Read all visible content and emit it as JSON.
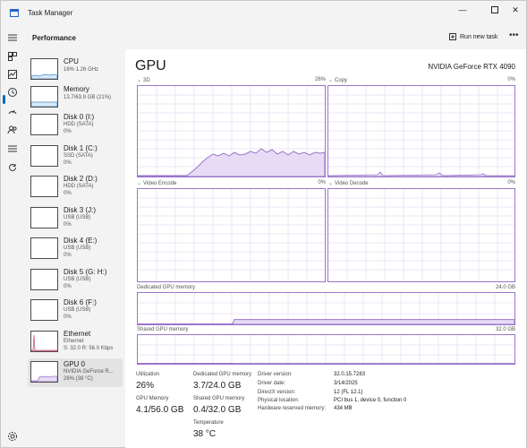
{
  "window": {
    "title": "Task Manager"
  },
  "header": {
    "title": "Performance",
    "run_new_task": "Run new task",
    "more_label": "•••"
  },
  "devices": [
    {
      "name": "CPU",
      "sub1": "16%  1.26 GHz",
      "sub2": ""
    },
    {
      "name": "Memory",
      "sub1": "13.7/63.9 GB (21%)",
      "sub2": ""
    },
    {
      "name": "Disk 0 (I:)",
      "sub1": "HDD (SATA)",
      "sub2": "0%"
    },
    {
      "name": "Disk 1 (C:)",
      "sub1": "SSD (SATA)",
      "sub2": "0%"
    },
    {
      "name": "Disk 2 (D:)",
      "sub1": "HDD (SATA)",
      "sub2": "0%"
    },
    {
      "name": "Disk 3 (J:)",
      "sub1": "USB (USB)",
      "sub2": "0%"
    },
    {
      "name": "Disk 4 (E:)",
      "sub1": "USB (USB)",
      "sub2": "0%"
    },
    {
      "name": "Disk 5 (G: H:)",
      "sub1": "USB (USB)",
      "sub2": "0%"
    },
    {
      "name": "Disk 6 (F:)",
      "sub1": "USB (USB)",
      "sub2": "0%"
    },
    {
      "name": "Ethernet",
      "sub1": "Ethernet",
      "sub2": "S: 32.0  R: 56.0 Kbps"
    },
    {
      "name": "GPU 0",
      "sub1": "NVIDIA GeForce R...",
      "sub2": "26%  (38 °C)"
    }
  ],
  "gpu": {
    "title": "GPU",
    "model": "NVIDIA GeForce RTX 4090",
    "engines": [
      {
        "label": "3D",
        "value": "26%"
      },
      {
        "label": "Copy",
        "value": "0%"
      },
      {
        "label": "Video Encode",
        "value": "0%"
      },
      {
        "label": "Video Decode",
        "value": "0%"
      }
    ],
    "dedicated": {
      "label": "Dedicated GPU memory",
      "max": "24.0 GB"
    },
    "shared": {
      "label": "Shared GPU memory",
      "max": "32.0 GB"
    }
  },
  "stats": {
    "utilization_label": "Utilization",
    "utilization": "26%",
    "gpu_memory_label": "GPU Memory",
    "gpu_memory": "4.1/56.0 GB",
    "dedicated_label": "Dedicated GPU memory",
    "dedicated": "3.7/24.0 GB",
    "shared_label": "Shared GPU memory",
    "shared": "0.4/32.0 GB",
    "temp_label": "Temperature",
    "temp": "38 °C"
  },
  "info": [
    {
      "key": "Driver version:",
      "value": "32.0.15.7283"
    },
    {
      "key": "Driver date:",
      "value": "3/14/2025"
    },
    {
      "key": "DirectX version:",
      "value": "12 (FL 12.1)"
    },
    {
      "key": "Physical location:",
      "value": "PCI bus 1, device 0, function 0"
    },
    {
      "key": "Hardware reserved memory:",
      "value": "434 MB"
    }
  ],
  "levels": {
    "gpu_3d": 0.26,
    "dedicated_memory": 0.154,
    "shared_memory": 0.0125
  },
  "colors": {
    "gpu_line": "#9a75c9",
    "gpu_fill": "#e7dbf6",
    "accent": "#0067c0"
  }
}
